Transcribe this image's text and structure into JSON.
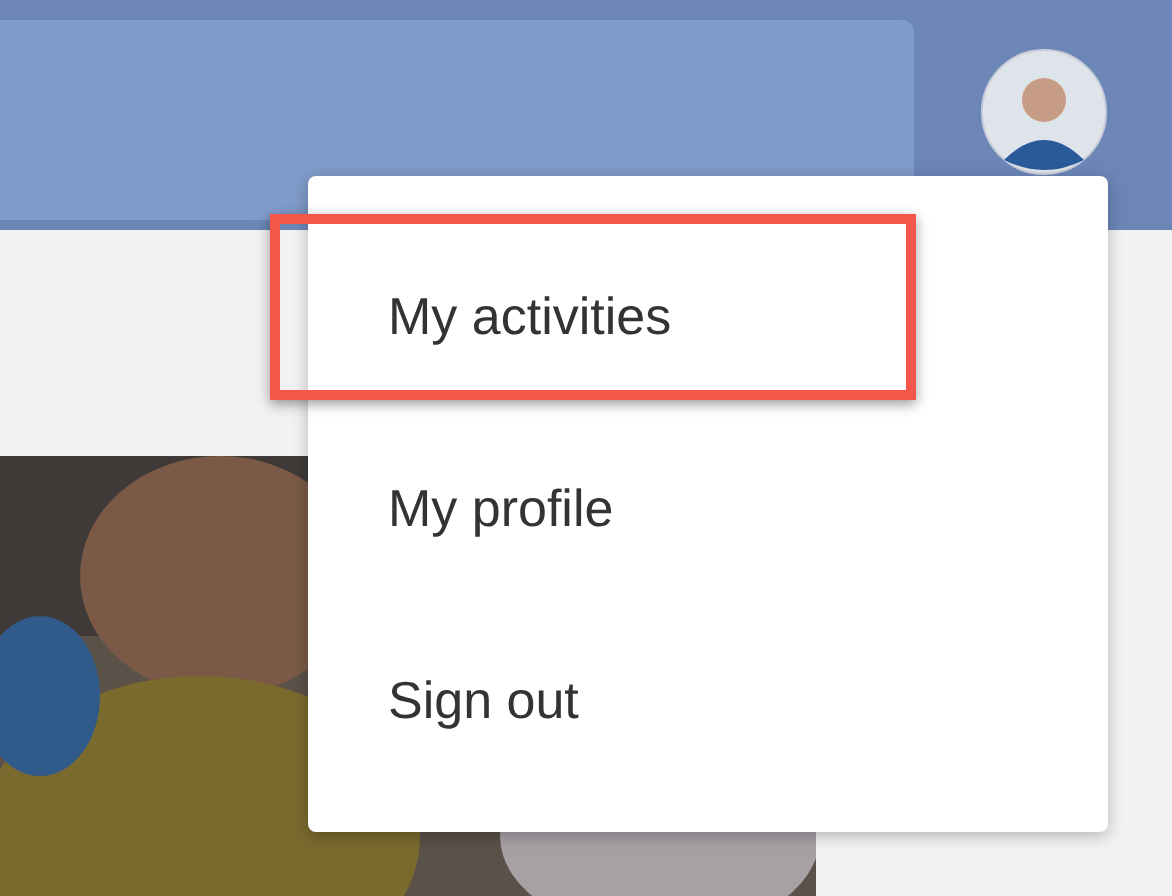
{
  "user_menu": {
    "items": [
      {
        "label": "My activities",
        "highlighted": true
      },
      {
        "label": "My profile",
        "highlighted": false
      },
      {
        "label": "Sign out",
        "highlighted": false
      }
    ]
  }
}
